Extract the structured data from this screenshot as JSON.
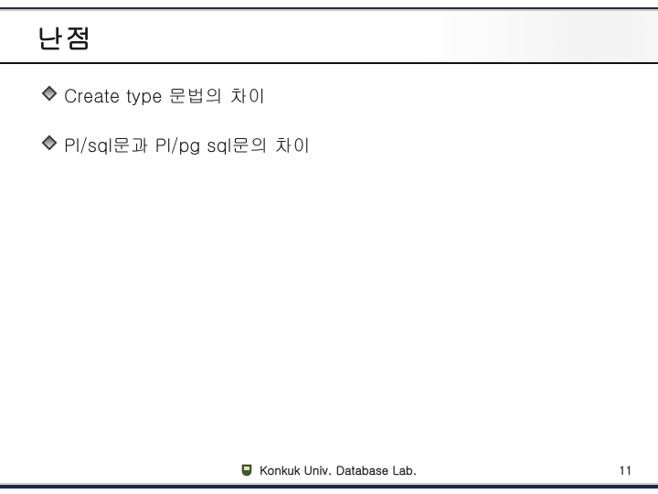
{
  "title": "난점",
  "bullets": [
    "Create type 문법의 차이",
    "Pl/sql문과 Pl/pg sql문의 차이"
  ],
  "footer": {
    "org": "Konkuk Univ. Database Lab.",
    "page": "11"
  }
}
